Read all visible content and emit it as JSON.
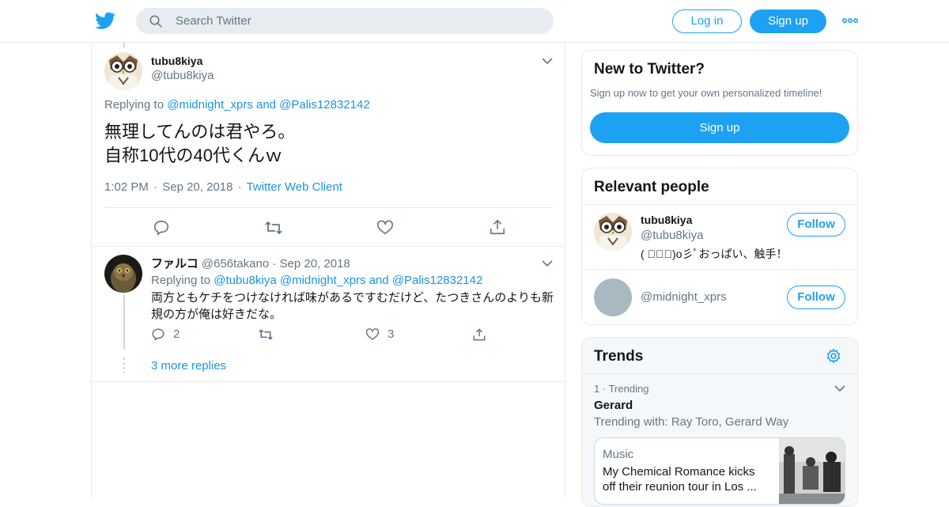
{
  "header": {
    "search_placeholder": "Search Twitter",
    "login_label": "Log in",
    "signup_label": "Sign up"
  },
  "main_tweet": {
    "display_name": "tubu8kiya",
    "handle": "@tubu8kiya",
    "replying_prefix": "Replying to",
    "replying_to_1": "@midnight_xprs",
    "replying_and": "and",
    "replying_to_2": "@Palis12832142",
    "text_line1": "無理してんのは君やろ。",
    "text_line2": "自称10代の40代くんｗ",
    "time": "1:02 PM",
    "date": "Sep 20, 2018",
    "source": "Twitter Web Client"
  },
  "reply": {
    "display_name": "ファルコ",
    "handle": "@656takano",
    "date": "Sep 20, 2018",
    "replying_prefix": "Replying to",
    "replying_to_1": "@tubu8kiya",
    "replying_to_2": "@midnight_xprs",
    "replying_and": "and",
    "replying_to_3": "@Palis12832142",
    "text": "両方ともケチをつけなければ味があるですむだけど、たつきさんのよりも新規の方が俺は好きだな。",
    "reply_count": "2",
    "like_count": "3",
    "more_replies": "3 more replies"
  },
  "sidebar": {
    "new_to_twitter": {
      "title": "New to Twitter?",
      "subtitle": "Sign up now to get your own personalized timeline!",
      "signup_label": "Sign up"
    },
    "relevant_people": {
      "title": "Relevant people",
      "people": [
        {
          "display_name": "tubu8kiya",
          "handle": "@tubu8kiya",
          "bio": "( ﾟ∀ﾟ)o彡ﾟおっぱい、触手！",
          "follow_label": "Follow"
        },
        {
          "display_name": "",
          "handle": "@midnight_xprs",
          "bio": "",
          "follow_label": "Follow"
        }
      ]
    },
    "trends": {
      "title": "Trends",
      "items": [
        {
          "rank": "1",
          "context": "Trending",
          "name": "Gerard",
          "trending_with": "Trending with: Ray Toro, Gerard Way",
          "card_category": "Music",
          "card_text": "My Chemical Romance kicks off their reunion tour in Los ..."
        }
      ]
    }
  },
  "colors": {
    "accent": "#1da1f2",
    "link": "#1b95e0",
    "muted": "#657786",
    "border": "#e6ecf0"
  }
}
